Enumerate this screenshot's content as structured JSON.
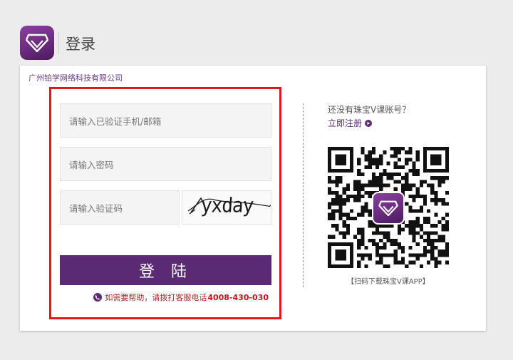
{
  "header": {
    "title": "登录",
    "logo_icon": "diamond-icon",
    "brand_color": "#5b2a74"
  },
  "card": {
    "company": "广州铂学网络科技有限公司"
  },
  "form": {
    "phone_placeholder": "请输入已验证手机/邮箱",
    "password_placeholder": "请输入密码",
    "captcha_placeholder": "请输入验证码",
    "captcha_text": "yxday",
    "login_label": "登 陆",
    "help_text": "如需要帮助，请拨打客服电话",
    "help_phone": "4008-430-030",
    "highlight_color": "#e0191e"
  },
  "side": {
    "no_account_text": "还没有珠宝V课账号？",
    "register_label": "立即注册",
    "qr_caption": "【扫码下载珠宝V课APP】"
  }
}
